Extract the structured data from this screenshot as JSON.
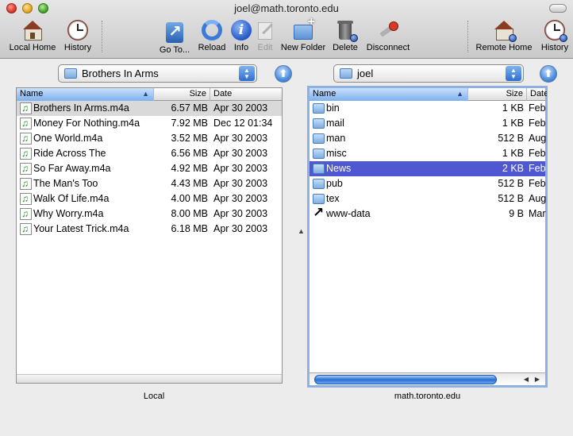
{
  "window": {
    "title": "joel@math.toronto.edu"
  },
  "toolbar": {
    "local_home": "Local Home",
    "history_left": "History",
    "goto": "Go To...",
    "reload": "Reload",
    "info": "Info",
    "edit": "Edit",
    "new_folder": "New Folder",
    "delete": "Delete",
    "disconnect": "Disconnect",
    "remote_home": "Remote Home",
    "history_right": "History"
  },
  "local": {
    "path": "Brothers In Arms",
    "label": "Local",
    "columns": {
      "name": "Name",
      "size": "Size",
      "date": "Date"
    },
    "files": [
      {
        "name": "Brothers In Arms.m4a",
        "size": "6.57 MB",
        "date": "Apr 30 2003"
      },
      {
        "name": "Money For Nothing.m4a",
        "size": "7.92 MB",
        "date": "Dec 12 01:34"
      },
      {
        "name": "One World.m4a",
        "size": "3.52 MB",
        "date": "Apr 30 2003"
      },
      {
        "name": "Ride Across The",
        "size": "6.56 MB",
        "date": "Apr 30 2003"
      },
      {
        "name": "So Far Away.m4a",
        "size": "4.92 MB",
        "date": "Apr 30 2003"
      },
      {
        "name": "The Man's Too",
        "size": "4.43 MB",
        "date": "Apr 30 2003"
      },
      {
        "name": "Walk Of Life.m4a",
        "size": "4.00 MB",
        "date": "Apr 30 2003"
      },
      {
        "name": "Why Worry.m4a",
        "size": "8.00 MB",
        "date": "Apr 30 2003"
      },
      {
        "name": "Your Latest Trick.m4a",
        "size": "6.18 MB",
        "date": "Apr 30 2003"
      }
    ]
  },
  "remote": {
    "path": "joel",
    "label": "math.toronto.edu",
    "columns": {
      "name": "Name",
      "size": "Size",
      "date": "Date"
    },
    "files": [
      {
        "name": "bin",
        "size": "1 KB",
        "date": "Feb"
      },
      {
        "name": "mail",
        "size": "1 KB",
        "date": "Feb"
      },
      {
        "name": "man",
        "size": "512 B",
        "date": "Aug"
      },
      {
        "name": "misc",
        "size": "1 KB",
        "date": "Feb"
      },
      {
        "name": "News",
        "size": "2 KB",
        "date": "Feb"
      },
      {
        "name": "pub",
        "size": "512 B",
        "date": "Feb"
      },
      {
        "name": "tex",
        "size": "512 B",
        "date": "Aug"
      },
      {
        "name": "www-data",
        "size": "9 B",
        "date": "Mar"
      }
    ]
  },
  "colors": {
    "selection": "#4f57d1",
    "sorted_header": "#7fb1ef",
    "accent": "#2a6ed4"
  }
}
